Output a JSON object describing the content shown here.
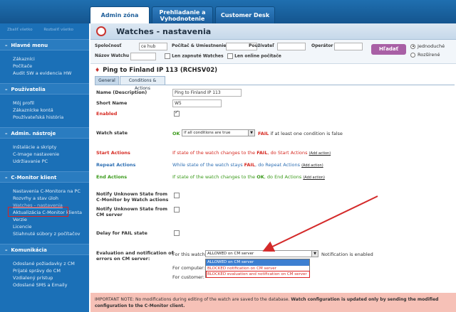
{
  "topnav": {
    "tabs": [
      {
        "label": "Admin zóna",
        "active": true
      },
      {
        "label": "Prehliadanie a Vyhodnotenie",
        "active": false
      },
      {
        "label": "Customer Desk",
        "active": false
      }
    ]
  },
  "sidebar": {
    "expand_all": "Zbaliť všetko",
    "collapse_all": "Rozbaliť všetko",
    "sections": [
      {
        "title": "Hlavné menu",
        "items": [
          "Zákazníci",
          "Počítače",
          "Audit SW a evidencia HW"
        ]
      },
      {
        "title": "Používatelia",
        "items": [
          "Môj profil",
          "Zákaznícke kontá",
          "Používateľská história"
        ]
      },
      {
        "title": "Admin. nástroje",
        "items": [
          "Inštalácie a skripty",
          "C-Image nastavenie",
          "Udržiavanie PC"
        ]
      },
      {
        "title": "C-Monitor klient",
        "items": [
          "Nastavenia C-Monitora na PC",
          "Rozvrhy a stav úloh",
          "Watches - nastavenia",
          "Aktualizácia C-Monitor klienta",
          "Verzie",
          "Licencie",
          "Stiahnuté súbory z počítačov"
        ]
      },
      {
        "title": "Komunikácia",
        "items": [
          "Odoslané požiadavky z CM",
          "Prijaté správy do CM",
          "Vzdialený prístup",
          "Odoslané SMS a Emaily"
        ]
      }
    ],
    "selected_item": "Watches - nastavenia"
  },
  "header": {
    "title": "Watches - nastavenia"
  },
  "filter": {
    "spolocnost_label": "Spoločnosť",
    "spolocnost_value": "ce hub",
    "pocitac_label": "Počítač & Umiestnenie",
    "pouzivatel_label": "Používateľ",
    "operator_label": "Operátor",
    "nazov_label": "Názov Watchu",
    "zapnute_label": "Len zapnuté Watches",
    "online_label": "Len online počítače",
    "search_button": "Hľadať",
    "radio_simple": "Jednoduché",
    "radio_extended": "Rozšírené"
  },
  "watch": {
    "title": "Ping to Finland IP 113 (RCHSV02)",
    "tabs": [
      "General",
      "Conditions & Actions"
    ],
    "name_label": "Name (Description)",
    "name_value": "Ping to Finland IP 113",
    "short_label": "Short Name",
    "short_value": "W5",
    "enabled_label": "Enabled",
    "state_label": "Watch state",
    "state_ok": "OK",
    "state_select": "if all conditions are true",
    "state_fail": "FAIL",
    "state_fail_text": "if at least one condition is false",
    "start_label": "Start Actions",
    "start_text_a": "If state of the watch changes to the",
    "start_text_b": "FAIL",
    "start_text_c": ", do",
    "start_text_d": "Start Actions",
    "repeat_label": "Repeat Actions",
    "repeat_text_a": "While state of the watch stays",
    "repeat_text_b": "FAIL",
    "repeat_text_c": ", do",
    "repeat_text_d": "Repeat Actions",
    "end_label": "End Actions",
    "end_text_a": "If state of the watch changes to the",
    "end_text_b": "OK",
    "end_text_c": ", do",
    "end_text_d": "End Actions",
    "add_action": "(Add action)",
    "notify_watch_label": "Notify Unknown State from C-Monitor by Watch actions",
    "notify_cm_label": "Notify Unknown State from CM server",
    "delay_label": "Delay for FAIL state",
    "eval_label": "Evaluation and notification of errors on CM server:",
    "for_watch": "For this watch:",
    "for_watch_value": "ALLOWED on CM server",
    "notif_enabled": "Notification is enabled",
    "for_computer": "For computer:",
    "for_customer": "For customer:",
    "options": [
      "ALLOWED on CM server",
      "BLOCKED notification on CM server",
      "BLOCKED evaluation and notification on CM server"
    ]
  },
  "note": {
    "prefix": "IMPORTANT NOTE: No modifications during editing of the watch are saved to the database.",
    "bold": "Watch configuration is updated only by sending the modified configuration to the C-Monitor client."
  },
  "colors": {
    "accent": "#1b70b7",
    "highlight": "#dd2222",
    "button": "#a85fa5"
  }
}
